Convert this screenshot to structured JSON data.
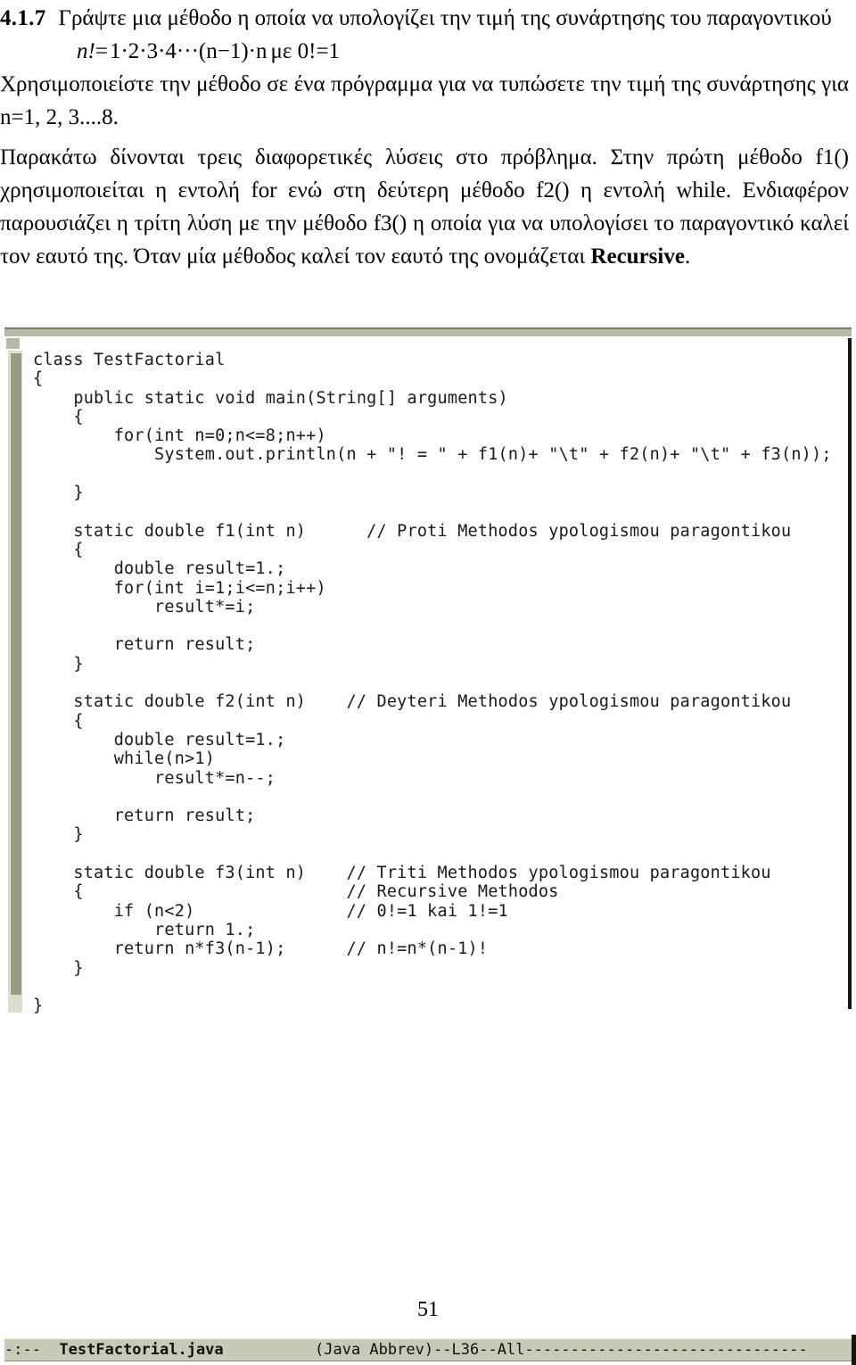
{
  "document": {
    "section_number": "4.1.7",
    "paragraph_1": "Γράψτε μια μέθοδο η οποία να υπολογίζει την τιμή της συνάρτησης του παραγοντικού",
    "formula": {
      "lhs": "n!",
      "equals": "=",
      "expansion": "1·2·3·4···(n−1)·n",
      "condition": "με 0!=1",
      "plain": "n!=1·2·3·4···(n−1)·n με 0!=1"
    },
    "paragraph_2": "Χρησιμοποιείστε την μέθοδο σε ένα πρόγραμμα για να τυπώσετε την τιμή της συνάρτησης για n=1, 2, 3....8.",
    "paragraph_3": "Παρακάτω δίνονται τρεις διαφορετικές λύσεις στο πρόβλημα. Στην πρώτη μέθοδο f1() χρησιμοποιείται η εντολή for ενώ στη δεύτερη μέθοδο f2() η εντολή while. Ενδιαφέρον παρουσιάζει η τρίτη λύση με την μέθοδο f3() η οποία για να υπολογίσει το παραγοντικό καλεί τον εαυτό της. Όταν μία μέθοδος καλεί τον εαυτό της ονομάζεται ",
    "paragraph_3_bold_term": "Recursive",
    "paragraph_3_end": ".",
    "page_number": "51"
  },
  "editor": {
    "code": "class TestFactorial\n{\n    public static void main(String[] arguments)\n    {\n        for(int n=0;n<=8;n++)\n            System.out.println(n + \"! = \" + f1(n)+ \"\\t\" + f2(n)+ \"\\t\" + f3(n));\n\n    }\n\n    static double f1(int n)      // Proti Methodos ypologismou paragontikou\n    {\n        double result=1.;\n        for(int i=1;i<=n;i++)\n            result*=i;\n\n        return result;\n    }\n\n    static double f2(int n)    // Deyteri Methodos ypologismou paragontikou\n    {\n        double result=1.;\n        while(n>1)\n            result*=n--;\n\n        return result;\n    }\n\n    static double f3(int n)    // Triti Methodos ypologismou paragontikou\n    {                          // Recursive Methodos\n        if (n<2)               // 0!=1 kai 1!=1\n            return 1.;\n        return n*f3(n-1);      // n!=n*(n-1)!\n    }\n\n}",
    "modeline": {
      "prefix": "-:--  ",
      "filename": "TestFactorial.java",
      "suffix": "          (Java Abbrev)--L36--All-------------------------------"
    }
  },
  "colors": {
    "modeline_bg": "#c9c9ba",
    "scrollbar_thumb": "#9a9a85",
    "scrollbar_track": "#dcdcd2",
    "window_border": "#15150f",
    "text": "#000000"
  }
}
